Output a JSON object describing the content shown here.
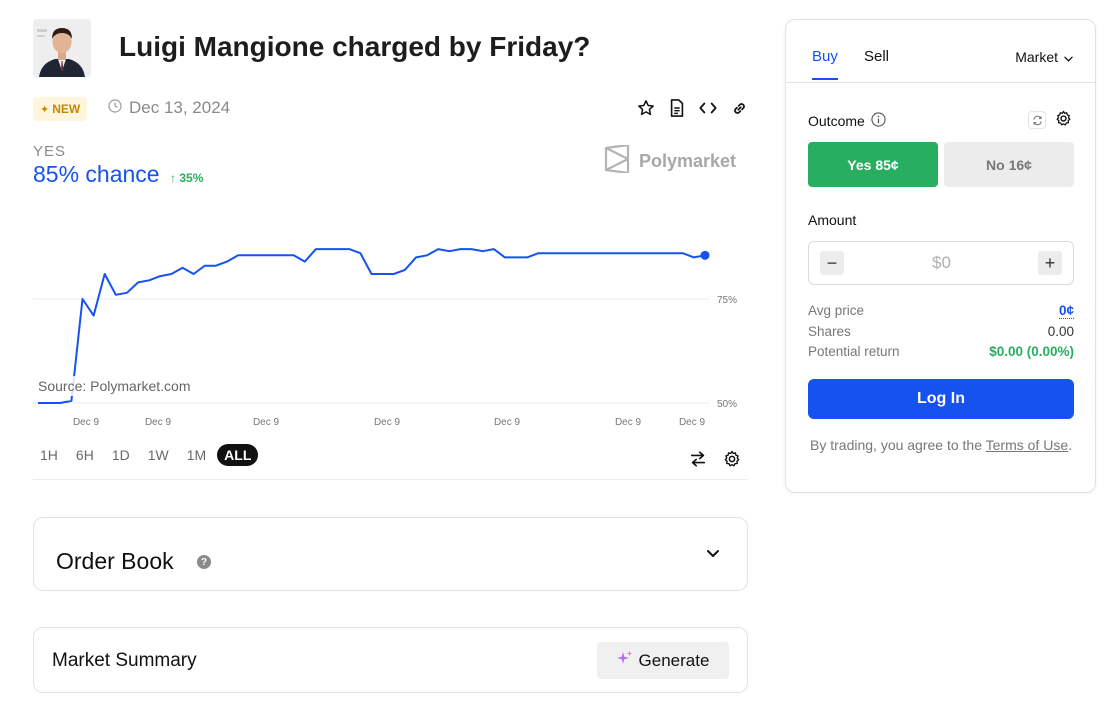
{
  "header": {
    "title": "Luigi Mangione charged by Friday?",
    "badge": "NEW",
    "date": "Dec 13, 2024"
  },
  "market": {
    "outcome_label": "YES",
    "chance_text": "85% chance",
    "change_text": "35%",
    "brand": "Polymarket",
    "source_text": "Source: Polymarket.com"
  },
  "chart_data": {
    "type": "line",
    "ylim": [
      50,
      100
    ],
    "yticks": [
      {
        "value": 50,
        "label": "50%"
      },
      {
        "value": 75,
        "label": "75%"
      }
    ],
    "xtick_labels": [
      "Dec 9",
      "Dec 9",
      "Dec 9",
      "Dec 9",
      "Dec 9",
      "Dec 9",
      "Dec 9"
    ],
    "series": [
      {
        "color": "#1652f0",
        "values": [
          50,
          50,
          50,
          50.5,
          75,
          71,
          81,
          76,
          76.5,
          79,
          79.5,
          80.5,
          81,
          82.5,
          81,
          83,
          83,
          84,
          85.5,
          85.5,
          85.5,
          85.5,
          85.5,
          85.5,
          84,
          87,
          87,
          87,
          87,
          86,
          81,
          81,
          81,
          82,
          85,
          85.5,
          87,
          86.5,
          87,
          87,
          86.5,
          87,
          85,
          85,
          85,
          86,
          86,
          86,
          86,
          86,
          86,
          86,
          86,
          86,
          86,
          86,
          86,
          86,
          86,
          85,
          85.5
        ]
      }
    ]
  },
  "time_ranges": [
    "1H",
    "6H",
    "1D",
    "1W",
    "1M",
    "ALL"
  ],
  "active_range": "ALL",
  "order_book": {
    "title": "Order Book"
  },
  "summary": {
    "title": "Market Summary",
    "generate_label": "Generate"
  },
  "trade": {
    "tab_buy": "Buy",
    "tab_sell": "Sell",
    "order_type": "Market",
    "outcome_label": "Outcome",
    "yes_button": "Yes 85¢",
    "no_button": "No 16¢",
    "amount_label": "Amount",
    "amount_placeholder": "$0",
    "avg_price_label": "Avg price",
    "avg_price_value": "0¢",
    "shares_label": "Shares",
    "shares_value": "0.00",
    "return_label": "Potential return",
    "return_value": "$0.00 (0.00%)",
    "login_label": "Log In",
    "terms_prefix": "By trading, you agree to the ",
    "terms_link": "Terms of Use",
    "terms_suffix": "."
  },
  "colors": {
    "accent": "#1652f0",
    "yes_green": "#27ae60",
    "badge_bg": "#fff6dd",
    "badge_text": "#c28a00"
  }
}
